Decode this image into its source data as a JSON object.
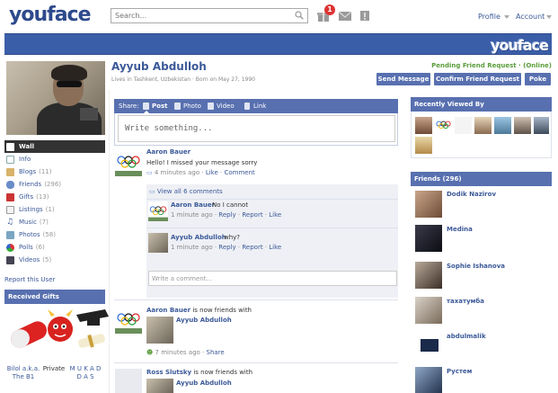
{
  "topbar": {
    "logo": "youface",
    "search_placeholder": "Search...",
    "notifications_count": "1",
    "profile_link": "Profile",
    "account_link": "Account"
  },
  "banner": {
    "logo": "youface"
  },
  "profile": {
    "name": "Ayyub Abdulloh",
    "info": "Lives in Tashkent, Uzbekistan · Born on May 27, 1990",
    "pending": "Pending Friend Request · (Online)",
    "buttons": {
      "send_message": "Send Message",
      "confirm": "Confirm Friend Request",
      "poke": "Poke"
    }
  },
  "menu": {
    "items": [
      {
        "label": "Wall",
        "count": ""
      },
      {
        "label": "Info",
        "count": ""
      },
      {
        "label": "Blogs",
        "count": "(11)"
      },
      {
        "label": "Friends",
        "count": "(296)"
      },
      {
        "label": "Gifts",
        "count": "(13)"
      },
      {
        "label": "Listings",
        "count": "(1)"
      },
      {
        "label": "Music",
        "count": "(7)"
      },
      {
        "label": "Photos",
        "count": "(58)"
      },
      {
        "label": "Polls",
        "count": "(6)"
      },
      {
        "label": "Videos",
        "count": "(5)"
      }
    ],
    "report": "Report this User"
  },
  "gifts": {
    "title": "Received Gifts",
    "labels": [
      "Bilol a.k.a. The B1",
      "Private",
      "M U K A D D A S"
    ]
  },
  "share": {
    "label": "Share:",
    "post": "Post",
    "photo": "Photo",
    "video": "Video",
    "link": "Link",
    "placeholder": "Write something..."
  },
  "feed": {
    "post1": {
      "author": "Aaron Bauer",
      "text": "Hello! I missed your message sorry",
      "time": "4 minutes ago",
      "like": "Like",
      "comment": "Comment",
      "view_all": "View all 6 comments",
      "comments": [
        {
          "author": "Aaron Bauer",
          "text": "No I cannot",
          "time": "1 minute ago",
          "reply": "Reply",
          "report": "Report",
          "like": "Like"
        },
        {
          "author": "Ayyub Abdulloh",
          "text": "why?",
          "time": "1 minute ago",
          "reply": "Reply",
          "report": "Report",
          "like": "Like"
        }
      ],
      "comment_placeholder": "Write a comment..."
    },
    "post2": {
      "author": "Aaron Bauer",
      "text": "is now friends with",
      "friend": "Ayyub Abdulloh",
      "time": "7 minutes ago",
      "share": "Share"
    },
    "post3": {
      "author": "Ross Slutsky",
      "text": "is now friends with",
      "friend": "Ayyub Abdulloh"
    }
  },
  "recent": {
    "title": "Recently Viewed By"
  },
  "friends": {
    "title": "Friends (296)",
    "list": [
      "Dodik Nazirov",
      "Medina",
      "Sophie Ishanova",
      "тахатумба",
      "abdulmalik",
      "Рустем"
    ]
  }
}
